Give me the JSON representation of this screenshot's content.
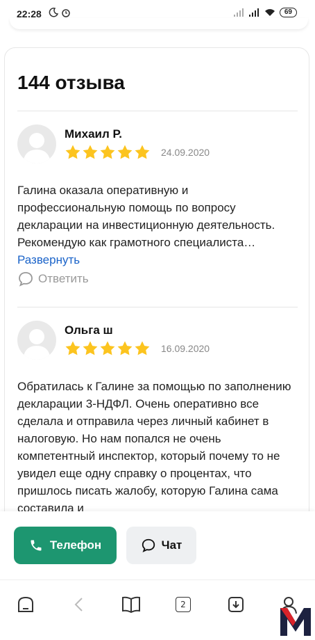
{
  "status_bar": {
    "time": "22:28",
    "battery": "69",
    "left_icons": [
      "moon-icon",
      "alarm-icon"
    ],
    "right_icons": [
      "signal-icon",
      "signal-icon",
      "wifi-icon",
      "battery-icon"
    ]
  },
  "reviews": {
    "count_title": "144 отзыва",
    "items": [
      {
        "name": "Михаил Р.",
        "rating": 5,
        "date": "24.09.2020",
        "text": "Галина оказала оперативную и профессиональную помощь по вопросу декларации на инвестиционную деятельность. Рекомендую как грамотного специалиста…",
        "expand_label": "Развернуть",
        "reply_label": "Ответить"
      },
      {
        "name": "Ольга ш",
        "rating": 5,
        "date": "16.09.2020",
        "text": "Обратилась к Галине за помощью по заполнению декларации 3-НДФЛ. Очень оперативно все сделала и отправила через личный кабинет в налоговую. Но нам попался не очень компетентный инспектор, который почему то не увидел еще одну справку о процентах, что пришлось писать жалобу, которую Галина сама составила и"
      }
    ]
  },
  "actions": {
    "phone_label": "Телефон",
    "chat_label": "Чат"
  },
  "browser_nav": {
    "tab_count": "2",
    "icons": [
      "home-icon",
      "back-icon",
      "book-icon",
      "tabs-icon",
      "download-icon",
      "profile-icon"
    ]
  },
  "colors": {
    "accent_green": "#1d9670",
    "star_yellow": "#fcc41f",
    "link_blue": "#1a63c9"
  }
}
